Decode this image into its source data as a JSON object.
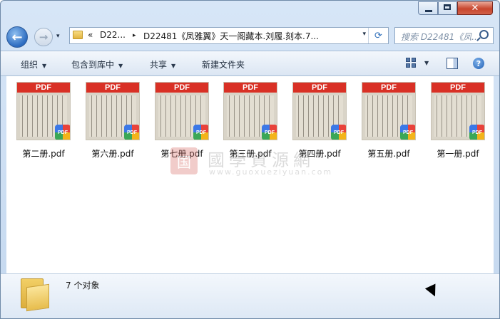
{
  "window": {
    "minimize_label": "",
    "maximize_label": "",
    "close_label": "✕"
  },
  "nav": {
    "back_glyph": "←",
    "forward_glyph": "→",
    "dropdown_glyph": "▾",
    "refresh_glyph": "⟳"
  },
  "address": {
    "overflow": "«",
    "crumb1": "D22...",
    "sep1": "▸",
    "crumb2": "D22481《凤雅翼》天一阁藏本.刘履.刻本.7...",
    "dropdown_glyph": "▾"
  },
  "search": {
    "placeholder": "搜索 D22481《凤..."
  },
  "toolbar": {
    "organize": "组织",
    "include_library": "包含到库中",
    "share": "共享",
    "new_folder": "新建文件夹",
    "caret": "▼",
    "help": "?"
  },
  "files": [
    {
      "name": "第二册.pdf",
      "thumb_label": "PDF",
      "badge": "PDF"
    },
    {
      "name": "第六册.pdf",
      "thumb_label": "PDF",
      "badge": "PDF"
    },
    {
      "name": "第七册.pdf",
      "thumb_label": "PDF",
      "badge": "PDF"
    },
    {
      "name": "第三册.pdf",
      "thumb_label": "PDF",
      "badge": "PDF"
    },
    {
      "name": "第四册.pdf",
      "thumb_label": "PDF",
      "badge": "PDF"
    },
    {
      "name": "第五册.pdf",
      "thumb_label": "PDF",
      "badge": "PDF"
    },
    {
      "name": "第一册.pdf",
      "thumb_label": "PDF",
      "badge": "PDF"
    }
  ],
  "watermark": {
    "seal": "国",
    "title": "國學資源網",
    "url": "www.guoxueziyuan.com"
  },
  "status": {
    "count_text": "7 个对象"
  }
}
